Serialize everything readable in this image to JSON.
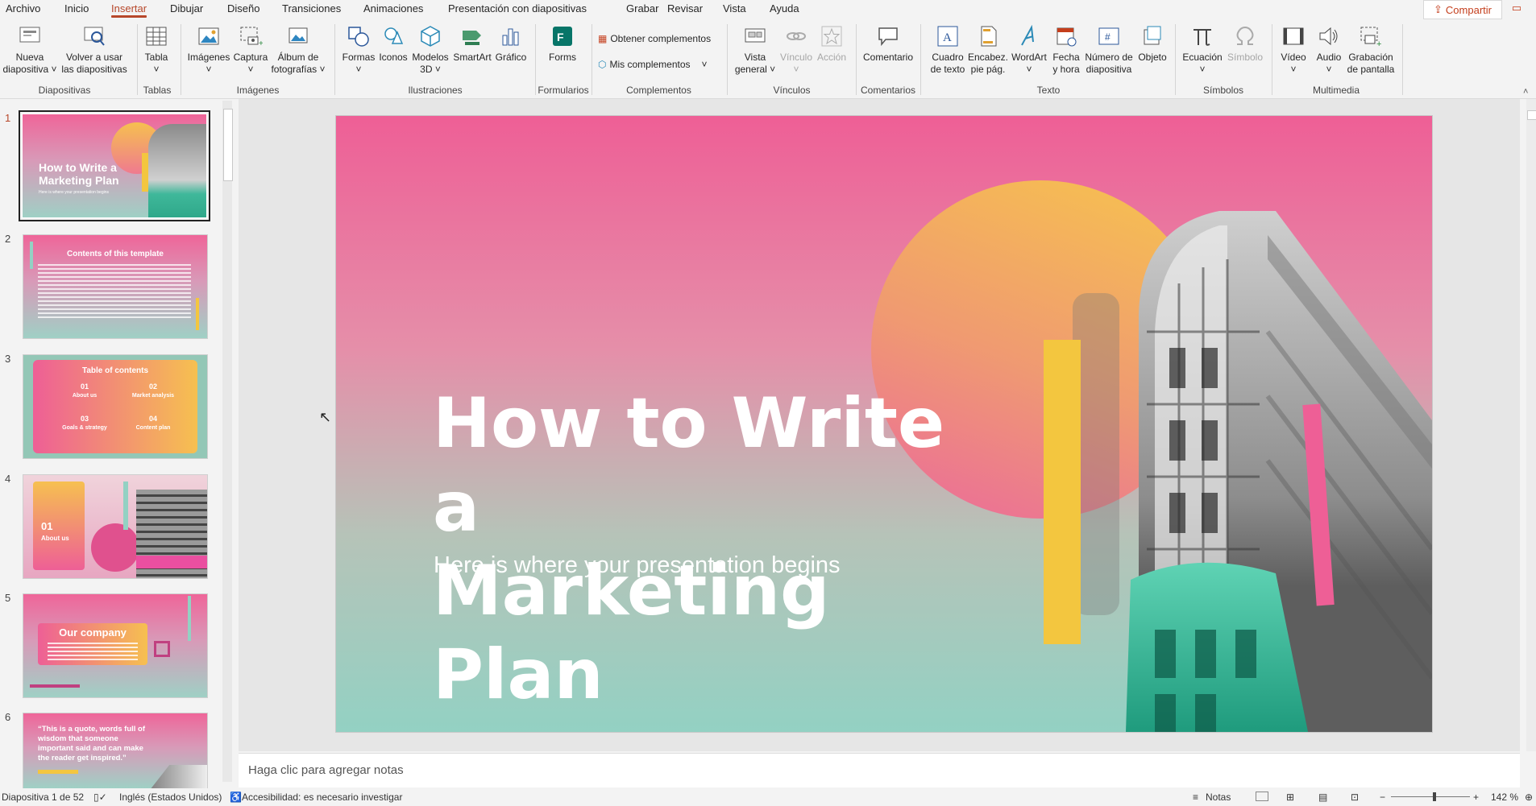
{
  "menu": {
    "tabs": [
      "Archivo",
      "Inicio",
      "Insertar",
      "Dibujar",
      "Diseño",
      "Transiciones",
      "Animaciones",
      "Presentación con diapositivas",
      "Grabar",
      "Revisar",
      "Vista",
      "Ayuda"
    ],
    "active_tab": "Insertar",
    "share_label": "Compartir"
  },
  "ribbon": {
    "diapositivas": {
      "nueva_1": "Nueva",
      "nueva_2": "diapositiva",
      "reuse_1": "Volver a usar",
      "reuse_2": "las diapositivas",
      "group": "Diapositivas"
    },
    "tablas": {
      "tabla": "Tabla",
      "group": "Tablas"
    },
    "imagenes": {
      "imagenes": "Imágenes",
      "captura": "Captura",
      "album_1": "Álbum de",
      "album_2": "fotografías",
      "group": "Imágenes"
    },
    "ilustraciones": {
      "formas": "Formas",
      "iconos": "Iconos",
      "modelos_1": "Modelos",
      "modelos_2": "3D",
      "smartart": "SmartArt",
      "grafico": "Gráfico",
      "group": "Ilustraciones"
    },
    "formularios": {
      "forms": "Forms",
      "group": "Formularios"
    },
    "complementos": {
      "obtener": "Obtener complementos",
      "mis": "Mis complementos",
      "group": "Complementos"
    },
    "vinculos": {
      "vista_1": "Vista",
      "vista_2": "general",
      "vinculo": "Vínculo",
      "accion": "Acción",
      "group": "Vínculos"
    },
    "comentarios": {
      "comentario": "Comentario",
      "group": "Comentarios"
    },
    "texto": {
      "cuadro_1": "Cuadro",
      "cuadro_2": "de texto",
      "encab_1": "Encabez.",
      "encab_2": "pie pág.",
      "wordart": "WordArt",
      "fecha_1": "Fecha",
      "fecha_2": "y hora",
      "numero_1": "Número de",
      "numero_2": "diapositiva",
      "objeto": "Objeto",
      "group": "Texto"
    },
    "simbolos": {
      "ecuacion": "Ecuación",
      "simbolo": "Símbolo",
      "group": "Símbolos"
    },
    "multimedia": {
      "video": "Vídeo",
      "audio": "Audio",
      "grab_1": "Grabación",
      "grab_2": "de pantalla",
      "group": "Multimedia"
    }
  },
  "thumbnails": [
    {
      "num": "1",
      "title_1": "How to Write a",
      "title_2": "Marketing Plan",
      "sub": "Here is where your presentation begins"
    },
    {
      "num": "2",
      "title": "Contents of this template"
    },
    {
      "num": "3",
      "title": "Table of contents",
      "items": [
        {
          "n": "01",
          "label": "About us"
        },
        {
          "n": "02",
          "label": "Market analysis"
        },
        {
          "n": "03",
          "label": "Goals & strategy"
        },
        {
          "n": "04",
          "label": "Content plan"
        }
      ]
    },
    {
      "num": "4",
      "n": "01",
      "label": "About us"
    },
    {
      "num": "5",
      "title": "Our company"
    },
    {
      "num": "6",
      "quote": "“This is a quote, words full of wisdom that someone important said and can make the reader get inspired.”"
    }
  ],
  "slide": {
    "title_line1": "How to Write a",
    "title_line2": "Marketing Plan",
    "subtitle": "Here is where your presentation begins"
  },
  "notes_placeholder": "Haga clic para agregar notas",
  "status": {
    "slide_count": "Diapositiva 1 de 52",
    "language": "Inglés (Estados Unidos)",
    "accessibility": "Accesibilidad: es necesario investigar",
    "notes": "Notas",
    "zoom": "142 %",
    "zoom_level": 0.55
  },
  "colors": {
    "accent": "#b7472a",
    "slide_pink": "#ee5f96",
    "slide_teal": "#93d1c3",
    "sun": "#f6c050",
    "bar_yellow": "#f3c63f"
  }
}
